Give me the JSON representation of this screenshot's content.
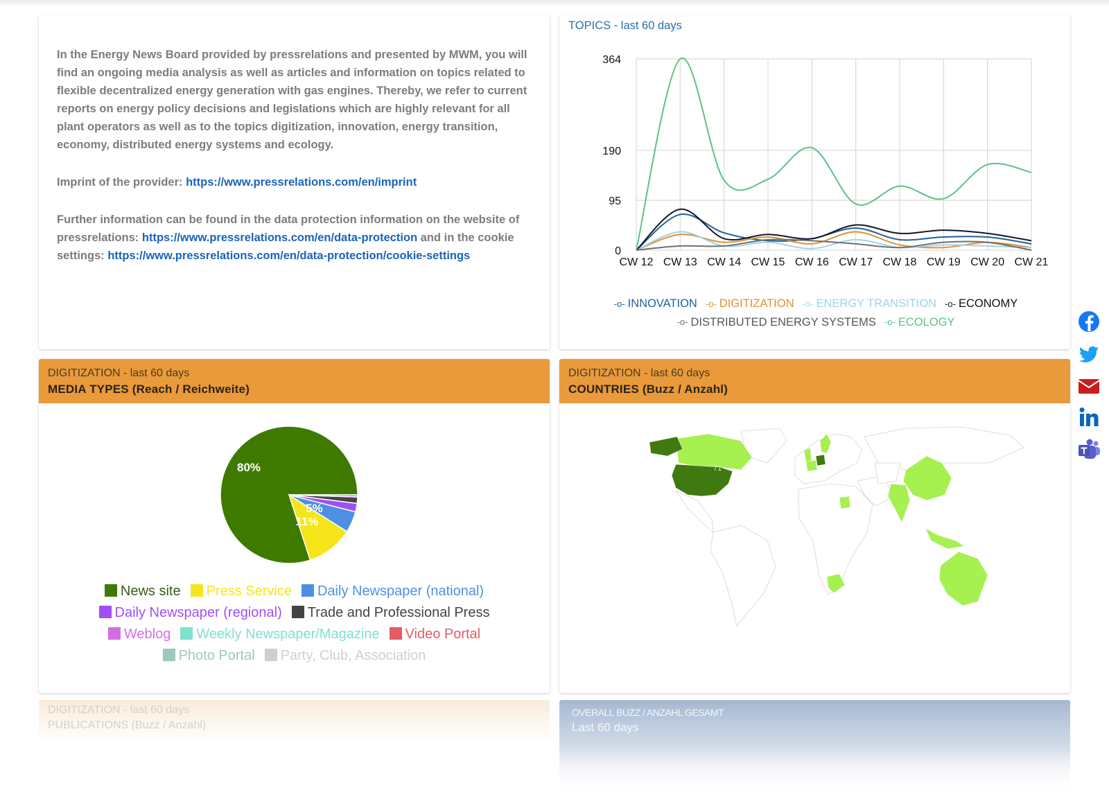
{
  "intro": {
    "paragraph1": "In the Energy News Board provided by pressrelations and presented by MWM, you will find an ongoing media analysis as well as articles and information on topics related to flexible decentralized energy generation with gas engines. Thereby, we refer to current reports on energy policy decisions and legislations which are highly relevant for all plant operators as well as to the topics digitization, innovation, energy transition, economy, distributed energy systems and ecology.",
    "imprint_prefix": "Imprint of the provider: ",
    "imprint_link": "https://www.pressrelations.com/en/imprint",
    "further_prefix": "Further information can be found in the data protection information on the website of pressrelations: ",
    "data_protection_link": "https://www.pressrelations.com/en/data-protection",
    "cookie_middle": " and in the cookie settings: ",
    "cookie_link": "https://www.pressrelations.com/en/data-protection/cookie-settings"
  },
  "topics": {
    "title": "TOPICS - last 60 days"
  },
  "media_types": {
    "subtitle": "DIGITIZATION - last 60 days",
    "title": "MEDIA TYPES (Reach / Reichweite)"
  },
  "countries": {
    "subtitle": "DIGITIZATION - last 60 days",
    "title": "COUNTRIES (Buzz / Anzahl)",
    "map_label": "71",
    "highlight_colors": {
      "high": "#3f7a10",
      "low": "#a6f04f",
      "none": "#ffffff"
    }
  },
  "publications": {
    "subtitle": "DIGITIZATION - last 60 days",
    "title": "PUBLICATIONS (Buzz / Anzahl)"
  },
  "overall": {
    "subtitle": "OVERALL BUZZ / ANZAHL GESAMT",
    "title": "Last 60 days"
  },
  "social": [
    {
      "name": "facebook-icon",
      "color": "#1877f2"
    },
    {
      "name": "twitter-icon",
      "color": "#1da1f2"
    },
    {
      "name": "mail-icon",
      "color": "#c81e1e"
    },
    {
      "name": "linkedin-icon",
      "color": "#0a66c2"
    },
    {
      "name": "teams-icon",
      "color": "#5b5fc7"
    }
  ],
  "chart_data": [
    {
      "type": "line",
      "title": "TOPICS - last 60 days",
      "categories": [
        "CW 12",
        "CW 13",
        "CW 14",
        "CW 15",
        "CW 16",
        "CW 17",
        "CW 18",
        "CW 19",
        "CW 20",
        "CW 21"
      ],
      "y_ticks": [
        0,
        95,
        190,
        364
      ],
      "ylim": [
        0,
        364
      ],
      "grid": true,
      "legend_position": "bottom",
      "series": [
        {
          "name": "INNOVATION",
          "color": "#1f5f99",
          "values": [
            0,
            68,
            33,
            18,
            22,
            42,
            20,
            25,
            25,
            12
          ]
        },
        {
          "name": "DIGITIZATION",
          "color": "#e0912f",
          "values": [
            0,
            30,
            15,
            25,
            12,
            35,
            10,
            5,
            15,
            5
          ]
        },
        {
          "name": "ENERGY TRANSITION",
          "color": "#9dd3ec",
          "values": [
            0,
            35,
            8,
            15,
            3,
            20,
            5,
            10,
            8,
            5
          ]
        },
        {
          "name": "ECONOMY",
          "color": "#11182a",
          "values": [
            0,
            78,
            22,
            30,
            22,
            48,
            32,
            38,
            32,
            18
          ]
        },
        {
          "name": "DISTRIBUTED ENERGY SYSTEMS",
          "color": "#6f6f6f",
          "values": [
            0,
            8,
            8,
            20,
            18,
            12,
            5,
            15,
            15,
            0
          ]
        },
        {
          "name": "ECOLOGY",
          "color": "#5cc286",
          "values": [
            0,
            364,
            133,
            135,
            195,
            88,
            122,
            98,
            163,
            148
          ]
        }
      ]
    },
    {
      "type": "pie",
      "title": "MEDIA TYPES (Reach / Reichweite)",
      "slice_labels_shown": [
        "80%",
        "11%",
        "5%"
      ],
      "slices": [
        {
          "name": "News site",
          "value": 80,
          "color": "#3f7a00"
        },
        {
          "name": "Press Service",
          "value": 11,
          "color": "#f5e51a"
        },
        {
          "name": "Daily Newspaper (national)",
          "value": 5,
          "color": "#4f8fe3"
        },
        {
          "name": "Daily Newspaper (regional)",
          "value": 2,
          "color": "#a14ef5"
        },
        {
          "name": "Trade and Professional Press",
          "value": 1.5,
          "color": "#444444"
        },
        {
          "name": "Weblog",
          "value": 0.5,
          "color": "#d56ee3"
        },
        {
          "name": "Weekly Newspaper/Magazine",
          "value": 0,
          "color": "#7fe0cf"
        },
        {
          "name": "Video Portal",
          "value": 0,
          "color": "#e45c68"
        },
        {
          "name": "Photo Portal",
          "value": 0,
          "color": "#9ec7be"
        },
        {
          "name": "Party, Club, Association",
          "value": 0,
          "color": "#cfcfcf"
        }
      ]
    }
  ]
}
